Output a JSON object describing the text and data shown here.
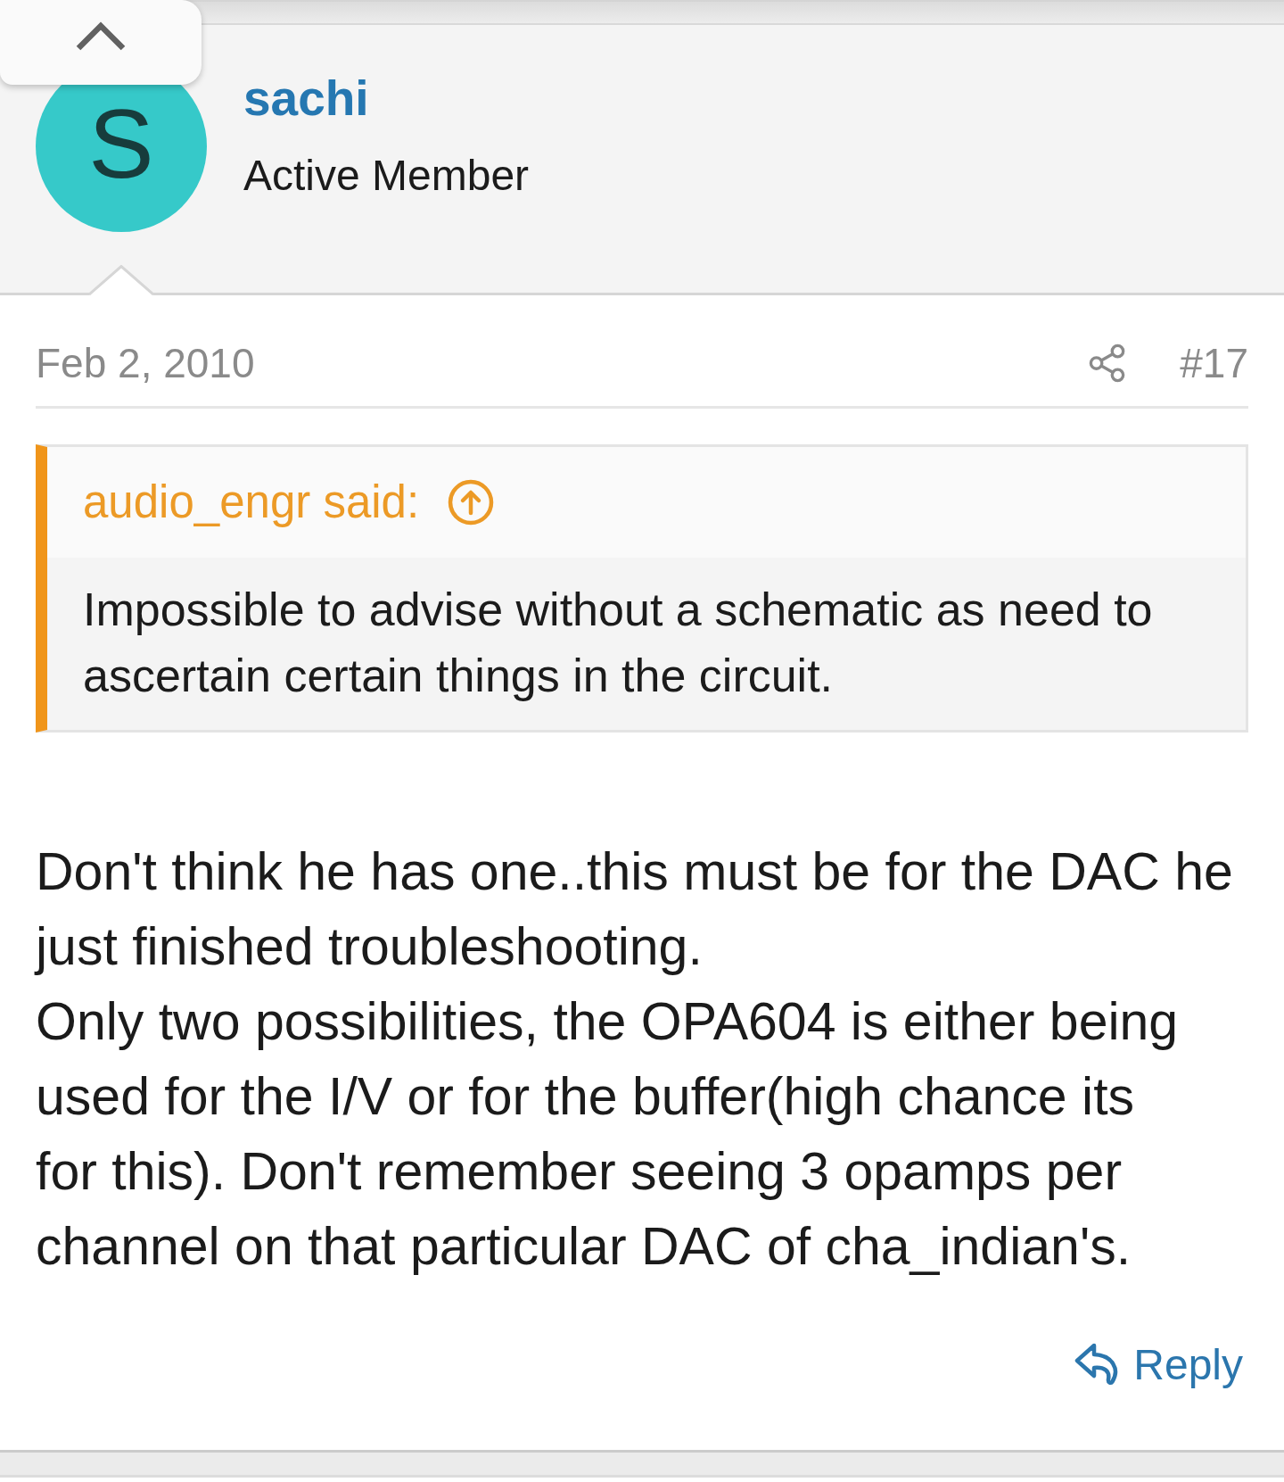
{
  "author": {
    "initial": "S",
    "name": "sachi",
    "title": "Active Member"
  },
  "post": {
    "date": "Feb 2, 2010",
    "number": "#17",
    "quote": {
      "attribution": "audio_engr said:",
      "text": "Impossible to advise without a schematic as need to ascertain certain things in the circuit."
    },
    "body": "Don't think he has one..this must be for the DAC he\njust finished troubleshooting.\nOnly two possibilities, the OPA604 is either being\nused for the I/V or for the buffer(high chance its\nfor this). Don't remember seeing 3 opamps per\nchannel on that particular DAC of cha_indian's.",
    "reply_label": "Reply"
  }
}
